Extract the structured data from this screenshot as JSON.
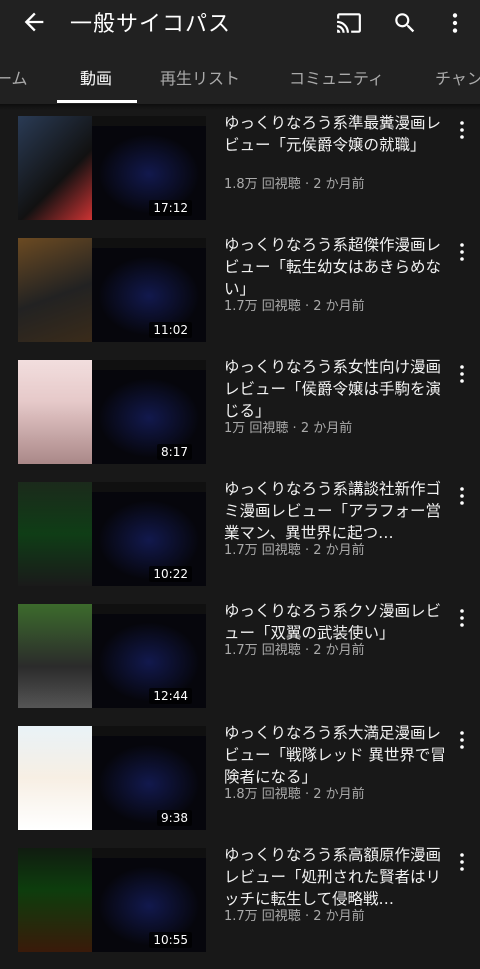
{
  "appbar": {
    "title": "一般サイコパス",
    "icons": [
      "back-arrow-icon",
      "cast-icon",
      "search-icon",
      "more-vert-icon"
    ]
  },
  "tabs": [
    {
      "label": "ーム",
      "active": false
    },
    {
      "label": "動画",
      "active": true
    },
    {
      "label": "再生リスト",
      "active": false
    },
    {
      "label": "コミュニティ",
      "active": false
    },
    {
      "label": "チャン",
      "active": false
    }
  ],
  "videos": [
    {
      "title": "ゆっくりなろう系準最糞漫画レビュー「元侯爵令嬢の就職」",
      "views": "1.8万 回視聴",
      "age": "2 か月前",
      "duration": "17:12"
    },
    {
      "title": "ゆっくりなろう系超傑作漫画レビュー「転生幼女はあきらめない」",
      "views": "1.7万 回視聴",
      "age": "2 か月前",
      "duration": "11:02"
    },
    {
      "title": "ゆっくりなろう系女性向け漫画レビュー「侯爵令嬢は手駒を演じる」",
      "views": "1万 回視聴",
      "age": "2 か月前",
      "duration": "8:17"
    },
    {
      "title": "ゆっくりなろう系講談社新作ゴミ漫画レビュー「アラフォー営業マン、異世界に起つ…",
      "views": "1.7万 回視聴",
      "age": "2 か月前",
      "duration": "10:22"
    },
    {
      "title": "ゆっくりなろう系クソ漫画レビュー「双翼の武装使い」",
      "views": "1.7万 回視聴",
      "age": "2 か月前",
      "duration": "12:44"
    },
    {
      "title": "ゆっくりなろう系大満足漫画レビュー「戦隊レッド 異世界で冒険者になる」",
      "views": "1.8万 回視聴",
      "age": "2 か月前",
      "duration": "9:38"
    },
    {
      "title": "ゆっくりなろう系高額原作漫画レビュー「処刑された賢者はリッチに転生して侵略戦…",
      "views": "1.7万 回視聴",
      "age": "2 か月前",
      "duration": "10:55"
    }
  ],
  "meta_separator": " · ",
  "colors": {
    "background": "#181818",
    "appbar": "#212121",
    "text": "#ffffff",
    "secondary_text": "#aaaaaa"
  }
}
